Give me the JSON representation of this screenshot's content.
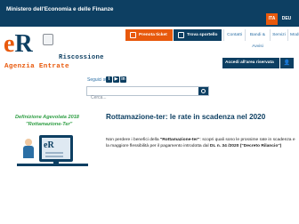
{
  "header": {
    "ministry": "Ministero dell'Economia e delle Finanze",
    "lang_active": "ITA",
    "lang_other": "DEU"
  },
  "logo": {
    "big": "eR",
    "line1": "Riscossione",
    "line2": "Agenzia Entrate"
  },
  "nav": {
    "prenota": "Prenota ticket",
    "sportello": "Trova sportello",
    "contatti": "Contatti",
    "bandi": "Bandi & Avvisi",
    "servizi": "Servizi",
    "modulistica": "Modulistica"
  },
  "reserved": {
    "label": "Accedi all'area riservata",
    "user_icon": "user-icon"
  },
  "social": {
    "label": "Seguici su",
    "items": [
      "twitter-icon",
      "youtube-icon",
      "linkedin-icon"
    ]
  },
  "search": {
    "placeholder": "Cerca..."
  },
  "feature": {
    "title1": "Definizione Agevolata 2018",
    "title2": "\"Rottamazione-Ter\"",
    "screen_text": "eR"
  },
  "article": {
    "title": "Rottamazione-ter: le rate in scadenza nel 2020",
    "body_parts": [
      "Non perdere i benefici della ",
      "\"Rottamazione-ter\"",
      ": scopri quali sono le prossime rate in scadenza e la maggiore flessibilità per il pagamento introdotta dal ",
      "DL n. 34 /2020 (\"Decreto Rilancio\")"
    ]
  },
  "colors": {
    "brand_blue": "#0d3f62",
    "accent_orange": "#e8590c",
    "green": "#2f9e44"
  }
}
